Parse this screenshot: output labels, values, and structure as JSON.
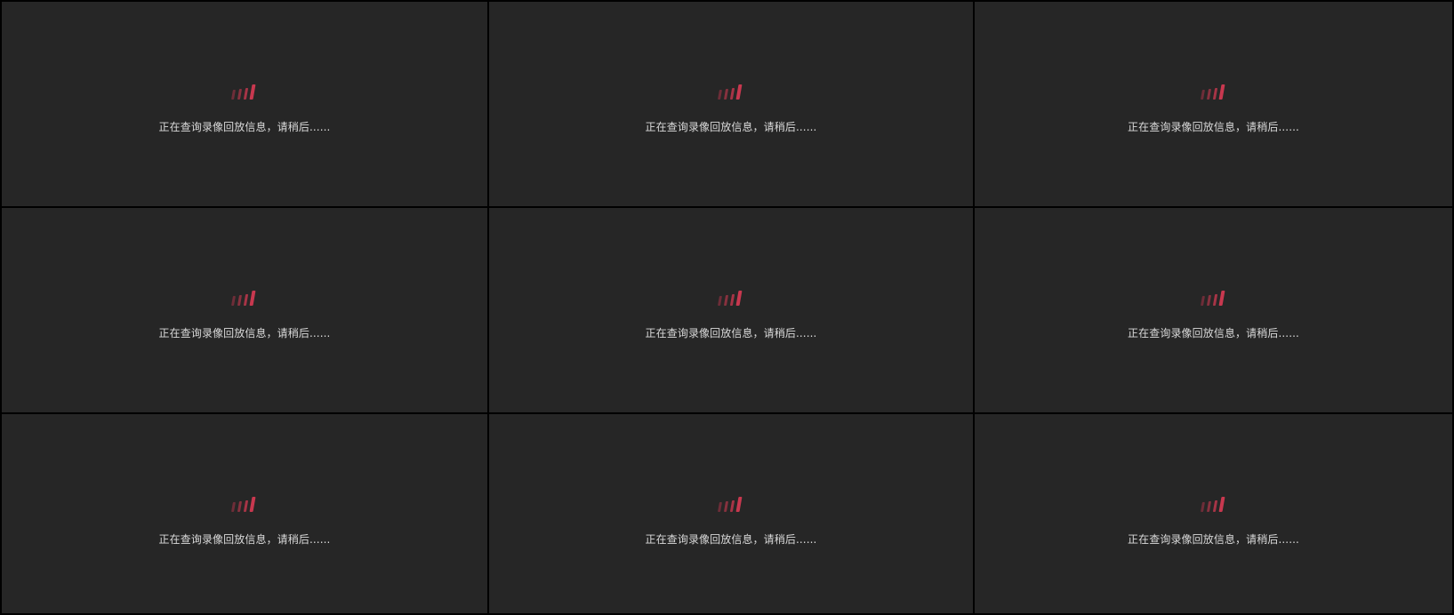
{
  "layout_label": "3x3",
  "cells": [
    {
      "message": "正在查询录像回放信息，请稍后......"
    },
    {
      "message": "正在查询录像回放信息，请稍后......"
    },
    {
      "message": "正在查询录像回放信息，请稍后......"
    },
    {
      "message": "正在查询录像回放信息，请稍后......"
    },
    {
      "message": "正在查询录像回放信息，请稍后......"
    },
    {
      "message": "正在查询录像回放信息，请稍后......"
    },
    {
      "message": "正在查询录像回放信息，请稍后......"
    },
    {
      "message": "正在查询录像回放信息，请稍后......"
    },
    {
      "message": "正在查询录像回放信息，请稍后......"
    }
  ],
  "colors": {
    "background": "#000000",
    "cell": "#262626",
    "accent": "#c8384f",
    "text": "#d9d9d9"
  },
  "icons": {
    "loading": "loading-bars-icon"
  }
}
